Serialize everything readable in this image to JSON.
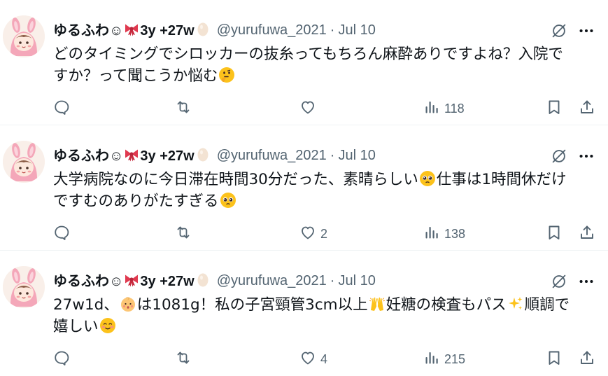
{
  "tweets": [
    {
      "display_name": "ゆるふわ☺",
      "name_suffix": "3y +27w",
      "handle": "@yurufuwa_2021",
      "separator": "·",
      "date": "Jul 10",
      "text_segments": [
        {
          "type": "text",
          "value": "どのタイミングでシロッカーの抜糸ってもちろん麻酔ありですよね？入院で"
        },
        {
          "type": "break"
        },
        {
          "type": "text",
          "value": "すか？って聞こうか悩む"
        },
        {
          "type": "emoji",
          "value": "thinking-face-emoji"
        }
      ],
      "likes": "",
      "views": "118"
    },
    {
      "display_name": "ゆるふわ☺",
      "name_suffix": "3y +27w",
      "handle": "@yurufuwa_2021",
      "separator": "·",
      "date": "Jul 10",
      "text_segments": [
        {
          "type": "text",
          "value": "大学病院なのに今日滞在時間30分だった、素晴らしい"
        },
        {
          "type": "emoji",
          "value": "pleading-face-emoji"
        },
        {
          "type": "text",
          "value": "仕事は1時間休だけ"
        },
        {
          "type": "break"
        },
        {
          "type": "text",
          "value": "ですむのありがたすぎる"
        },
        {
          "type": "emoji",
          "value": "pleading-face-emoji"
        }
      ],
      "likes": "2",
      "views": "138"
    },
    {
      "display_name": "ゆるふわ☺",
      "name_suffix": "3y +27w",
      "handle": "@yurufuwa_2021",
      "separator": "·",
      "date": "Jul 10",
      "text_segments": [
        {
          "type": "text",
          "value": "27w1d、"
        },
        {
          "type": "emoji",
          "value": "baby-emoji"
        },
        {
          "type": "text",
          "value": "は1081g！私の子宮頸管3cm以上"
        },
        {
          "type": "emoji",
          "value": "raising-hands-emoji"
        },
        {
          "type": "text",
          "value": "妊糖の検査もパス"
        },
        {
          "type": "emoji",
          "value": "sparkles-emoji"
        },
        {
          "type": "text",
          "value": "順調で"
        },
        {
          "type": "break"
        },
        {
          "type": "text",
          "value": "嬉しい"
        },
        {
          "type": "emoji",
          "value": "smiling-face-emoji"
        }
      ],
      "likes": "4",
      "views": "215"
    }
  ],
  "icons": {
    "name_emojis": [
      "ribbon-emoji",
      "egg-emoji"
    ],
    "actions": [
      "reply-icon",
      "retweet-icon",
      "like-icon",
      "views-icon",
      "bookmark-icon",
      "share-icon"
    ],
    "header": [
      "grok-icon",
      "more-icon"
    ]
  },
  "colors": {
    "text": "#0f1419",
    "secondary": "#536471",
    "divider": "#eff3f4",
    "avatar_pink": "#f4a7b9"
  }
}
